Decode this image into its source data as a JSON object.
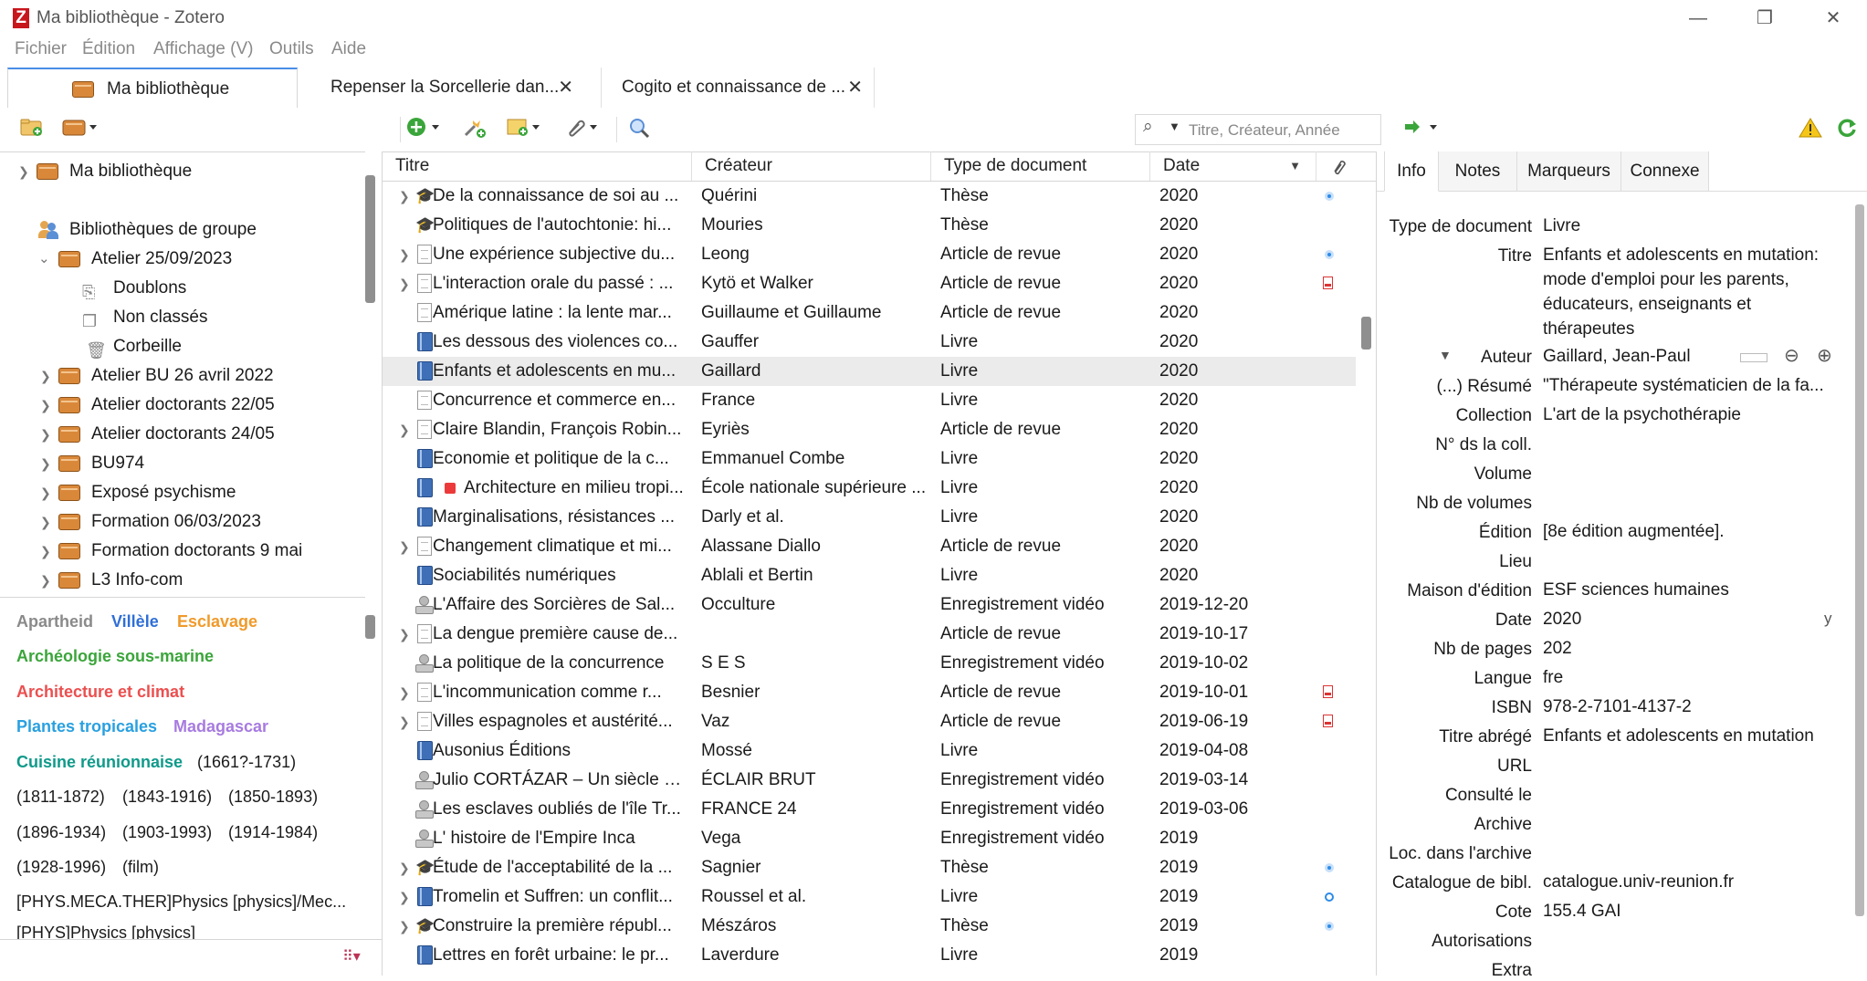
{
  "window": {
    "title": "Ma bibliothèque - Zotero",
    "logo": "Z",
    "minimize": "—",
    "maximize": "❐",
    "close": "✕"
  },
  "menu": [
    {
      "label": "Fichier"
    },
    {
      "label": "Édition"
    },
    {
      "label": "Affichage (V)"
    },
    {
      "label": "Outils"
    },
    {
      "label": "Aide"
    }
  ],
  "tabs": [
    {
      "label": "Ma bibliothèque"
    },
    {
      "label": "Repenser la Sorcellerie dan...",
      "close": "✕"
    },
    {
      "label": "Cogito et connaissance de ...",
      "close": "✕"
    }
  ],
  "toolbar": {
    "search_placeholder": "Titre, Créateur, Année",
    "icons": [
      "new-collection-icon",
      "new-library-icon",
      "new-item-icon",
      "add-by-identifier-icon",
      "new-note-icon",
      "add-attachment-icon",
      "advanced-search-icon",
      "locate-icon",
      "sync-error-icon",
      "sync-icon"
    ]
  },
  "tree": {
    "root": "Ma bibliothèque",
    "group_header": "Bibliothèques de groupe",
    "groups": [
      {
        "label": "Atelier 25/09/2023",
        "expanded": true,
        "children": [
          "Doublons",
          "Non classés",
          "Corbeille"
        ]
      },
      {
        "label": "Atelier BU 26 avril 2022"
      },
      {
        "label": "Atelier doctorants 22/05"
      },
      {
        "label": "Atelier doctorants 24/05"
      },
      {
        "label": "BU974"
      },
      {
        "label": "Exposé psychisme"
      },
      {
        "label": "Formation 06/03/2023"
      },
      {
        "label": "Formation doctorants 9 mai"
      },
      {
        "label": "L3 Info-com"
      }
    ]
  },
  "tags": [
    {
      "label": "Apartheid",
      "color": "#8a8a8a"
    },
    {
      "label": "Villèle",
      "color": "#2f6fd6"
    },
    {
      "label": "Esclavage",
      "color": "#f09a2a"
    },
    {
      "label": "Archéologie sous-marine",
      "color": "#3ba53b"
    },
    {
      "label": "Architecture et climat",
      "color": "#ec4f4f"
    },
    {
      "label": "Plantes tropicales",
      "color": "#2aa0e0"
    },
    {
      "label": "Madagascar",
      "color": "#a77be0"
    },
    {
      "label": "Cuisine réunionnaise",
      "color": "#0f9a8a"
    },
    {
      "label": "(1661?-1731)"
    },
    {
      "label": "(1811-1872)"
    },
    {
      "label": "(1843-1916)"
    },
    {
      "label": "(1850-1893)"
    },
    {
      "label": "(1896-1934)"
    },
    {
      "label": "(1903-1993)"
    },
    {
      "label": "(1914-1984)"
    },
    {
      "label": "(1928-1996)"
    },
    {
      "label": "(film)"
    },
    {
      "label": "[PHYS.MECA.THER]Physics [physics]/Mec..."
    },
    {
      "label": "[PHYS]Physics [physics]"
    }
  ],
  "columns": {
    "title": "Titre",
    "creator": "Créateur",
    "type": "Type de document",
    "date": "Date",
    "sort": "▼"
  },
  "items": [
    {
      "title": "De la connaissance de soi au ...",
      "creator": "Quérini",
      "type": "Thèse",
      "date": "2020",
      "icon": "thesis",
      "twisty": true,
      "att": "center"
    },
    {
      "title": "Politiques de l'autochtonie: hi...",
      "creator": "Mouries",
      "type": "Thèse",
      "date": "2020",
      "icon": "thesis",
      "twisty": false,
      "att": ""
    },
    {
      "title": "Une expérience subjective du...",
      "creator": "Leong",
      "type": "Article de revue",
      "date": "2020",
      "icon": "article",
      "twisty": true,
      "att": "center"
    },
    {
      "title": "L'interaction orale du passé : ...",
      "creator": "Kytö et Walker",
      "type": "Article de revue",
      "date": "2020",
      "icon": "article",
      "twisty": true,
      "att": "pdf"
    },
    {
      "title": "Amérique latine : la lente mar...",
      "creator": "Guillaume et Guillaume",
      "type": "Article de revue",
      "date": "2020",
      "icon": "article",
      "twisty": false,
      "att": ""
    },
    {
      "title": "Les dessous des violences co...",
      "creator": "Gauffer",
      "type": "Livre",
      "date": "2020",
      "icon": "book",
      "twisty": false,
      "att": ""
    },
    {
      "title": "Enfants et adolescents en mu...",
      "creator": "Gaillard",
      "type": "Livre",
      "date": "2020",
      "icon": "book",
      "twisty": false,
      "att": "",
      "selected": true
    },
    {
      "title": "Concurrence et commerce en...",
      "creator": "France",
      "type": "Livre",
      "date": "2020",
      "icon": "article",
      "twisty": false,
      "att": ""
    },
    {
      "title": "Claire Blandin, François Robin...",
      "creator": "Eyriès",
      "type": "Article de revue",
      "date": "2020",
      "icon": "article",
      "twisty": true,
      "att": ""
    },
    {
      "title": "Economie et politique de la c...",
      "creator": "Emmanuel Combe",
      "type": "Livre",
      "date": "2020",
      "icon": "book",
      "twisty": false,
      "att": ""
    },
    {
      "title": "Architecture en milieu tropi...",
      "creator": "École nationale supérieure ...",
      "type": "Livre",
      "date": "2020",
      "icon": "book",
      "twisty": false,
      "att": "",
      "redtag": true
    },
    {
      "title": "Marginalisations, résistances ...",
      "creator": "Darly et al.",
      "type": "Livre",
      "date": "2020",
      "icon": "book",
      "twisty": false,
      "att": ""
    },
    {
      "title": "Changement climatique et mi...",
      "creator": "Alassane Diallo",
      "type": "Article de revue",
      "date": "2020",
      "icon": "article",
      "twisty": true,
      "att": ""
    },
    {
      "title": "Sociabilités numériques",
      "creator": "Ablali et Bertin",
      "type": "Livre",
      "date": "2020",
      "icon": "book",
      "twisty": false,
      "att": ""
    },
    {
      "title": "L'Affaire des Sorcières de Sal...",
      "creator": "Occulture",
      "type": "Enregistrement vidéo",
      "date": "2019-12-20",
      "icon": "video",
      "twisty": false,
      "att": ""
    },
    {
      "title": "La dengue première cause de...",
      "creator": "",
      "type": "Article de revue",
      "date": "2019-10-17",
      "icon": "article",
      "twisty": true,
      "att": ""
    },
    {
      "title": "La politique de la concurrence",
      "creator": "S E S",
      "type": "Enregistrement vidéo",
      "date": "2019-10-02",
      "icon": "video",
      "twisty": false,
      "att": ""
    },
    {
      "title": "L'incommunication comme r...",
      "creator": "Besnier",
      "type": "Article de revue",
      "date": "2019-10-01",
      "icon": "article",
      "twisty": true,
      "att": "pdf"
    },
    {
      "title": "Villes espagnoles et austérité...",
      "creator": "Vaz",
      "type": "Article de revue",
      "date": "2019-06-19",
      "icon": "article",
      "twisty": true,
      "att": "pdf"
    },
    {
      "title": "Ausonius Éditions",
      "creator": "Mossé",
      "type": "Livre",
      "date": "2019-04-08",
      "icon": "book",
      "twisty": false,
      "att": ""
    },
    {
      "title": "Julio CORTÁZAR – Un siècle d...",
      "creator": "ÉCLAIR BRUT",
      "type": "Enregistrement vidéo",
      "date": "2019-03-14",
      "icon": "video",
      "twisty": false,
      "att": ""
    },
    {
      "title": "Les esclaves oubliés de l'île Tr...",
      "creator": "FRANCE 24",
      "type": "Enregistrement vidéo",
      "date": "2019-03-06",
      "icon": "video",
      "twisty": false,
      "att": ""
    },
    {
      "title": "L' histoire de l'Empire Inca",
      "creator": "Vega",
      "type": "Enregistrement vidéo",
      "date": "2019",
      "icon": "video",
      "twisty": false,
      "att": ""
    },
    {
      "title": "Étude de l'acceptabilité de la ...",
      "creator": "Sagnier",
      "type": "Thèse",
      "date": "2019",
      "icon": "thesis",
      "twisty": true,
      "att": "center"
    },
    {
      "title": "Tromelin et Suffren: un conflit...",
      "creator": "Roussel et al.",
      "type": "Livre",
      "date": "2019",
      "icon": "book",
      "twisty": true,
      "att": "hollow"
    },
    {
      "title": "Construire la première républ...",
      "creator": "Mészáros",
      "type": "Thèse",
      "date": "2019",
      "icon": "thesis",
      "twisty": true,
      "att": "center"
    },
    {
      "title": "Lettres en forêt urbaine: le pr...",
      "creator": "Laverdure",
      "type": "Livre",
      "date": "2019",
      "icon": "book",
      "twisty": false,
      "att": ""
    }
  ],
  "info_tabs": [
    {
      "label": "Info"
    },
    {
      "label": "Notes"
    },
    {
      "label": "Marqueurs"
    },
    {
      "label": "Connexe"
    }
  ],
  "info": {
    "fields": [
      {
        "label": "Type de document",
        "value": "Livre"
      },
      {
        "label": "Titre",
        "value": "Enfants et adolescents en mutation: mode d'emploi pour les parents, éducateurs, enseignants et thérapeutes"
      },
      {
        "label": "Auteur",
        "value": "Gaillard, Jean-Paul"
      },
      {
        "label": "(...) Résumé",
        "value": "\"Thérapeute systématicien de la fa..."
      },
      {
        "label": "Collection",
        "value": "L'art de la psychothérapie"
      },
      {
        "label": "N° ds la coll.",
        "value": ""
      },
      {
        "label": "Volume",
        "value": ""
      },
      {
        "label": "Nb de volumes",
        "value": ""
      },
      {
        "label": "Édition",
        "value": "[8e édition augmentée]."
      },
      {
        "label": "Lieu",
        "value": ""
      },
      {
        "label": "Maison d'édition",
        "value": "ESF sciences humaines"
      },
      {
        "label": "Date",
        "value": "2020"
      },
      {
        "label": "Nb de pages",
        "value": "202"
      },
      {
        "label": "Langue",
        "value": "fre"
      },
      {
        "label": "ISBN",
        "value": "978-2-7101-4137-2"
      },
      {
        "label": "Titre abrégé",
        "value": "Enfants et adolescents en mutation"
      },
      {
        "label": "URL",
        "value": ""
      },
      {
        "label": "Consulté le",
        "value": ""
      },
      {
        "label": "Archive",
        "value": ""
      },
      {
        "label": "Loc. dans l'archive",
        "value": ""
      },
      {
        "label": "Catalogue de bibl.",
        "value": "catalogue.univ-reunion.fr"
      },
      {
        "label": "Cote",
        "value": "155.4 GAI"
      },
      {
        "label": "Autorisations",
        "value": ""
      },
      {
        "label": "Extra",
        "value": ""
      }
    ],
    "date_suffix": "y",
    "creator_twisty": "▼"
  }
}
